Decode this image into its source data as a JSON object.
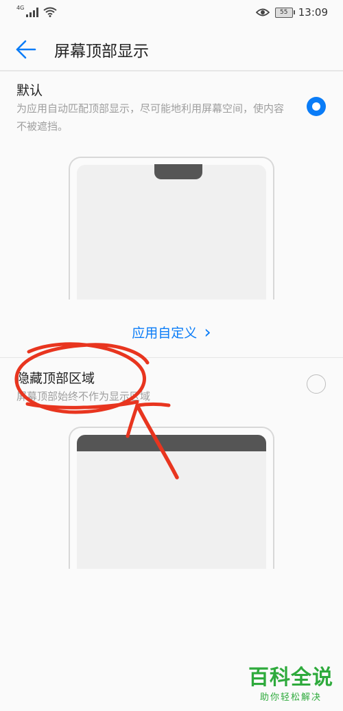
{
  "status_bar": {
    "network_label": "4G",
    "battery_level": "55",
    "time": "13:09"
  },
  "header": {
    "title": "屏幕顶部显示"
  },
  "options": [
    {
      "title": "默认",
      "description": "为应用自动匹配顶部显示，尽可能地利用屏幕空间，使内容不被遮挡。",
      "selected": true
    },
    {
      "title": "隐藏顶部区域",
      "description": "屏幕顶部始终不作为显示区域",
      "selected": false
    }
  ],
  "customize_link": {
    "label": "应用自定义",
    "chevron": "›"
  },
  "annotation": {
    "color": "#e8351f"
  },
  "watermark": {
    "main": "百科全说",
    "sub": "助你轻松解决"
  },
  "colors": {
    "accent": "#0a7cf7",
    "text_primary": "#212121",
    "text_secondary": "#9e9e9e"
  }
}
